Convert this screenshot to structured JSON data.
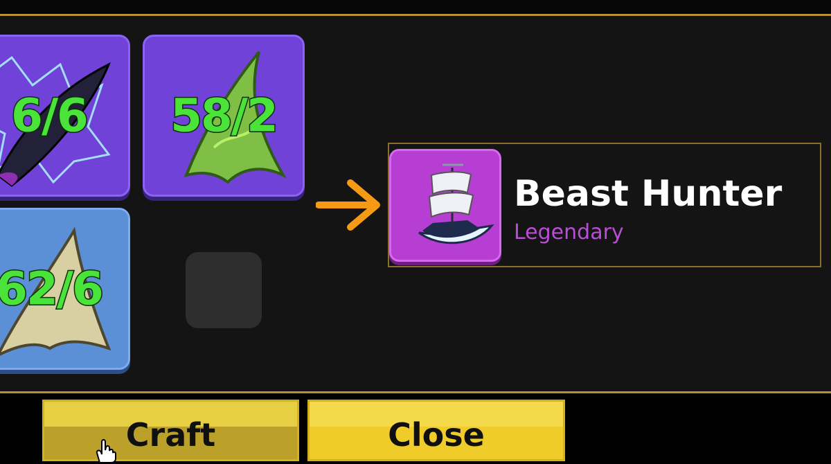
{
  "materials": [
    {
      "count": "6/6",
      "icon": "dark-horn-icon",
      "color": "#7042d8"
    },
    {
      "count": "58/2",
      "icon": "green-fang-icon",
      "color": "#7042d8"
    },
    {
      "count": "62/6",
      "icon": "bone-tooth-icon",
      "color": "#5b8fd6"
    }
  ],
  "result": {
    "name": "Beast Hunter",
    "rarity": "Legendary",
    "icon": "ship-icon",
    "rarity_color": "#b84ed6"
  },
  "buttons": {
    "craft_label": "Craft",
    "close_label": "Close"
  },
  "colors": {
    "accent_gold": "#b8902f",
    "button_yellow": "#f0cc2a",
    "arrow_orange": "#f59a14"
  }
}
